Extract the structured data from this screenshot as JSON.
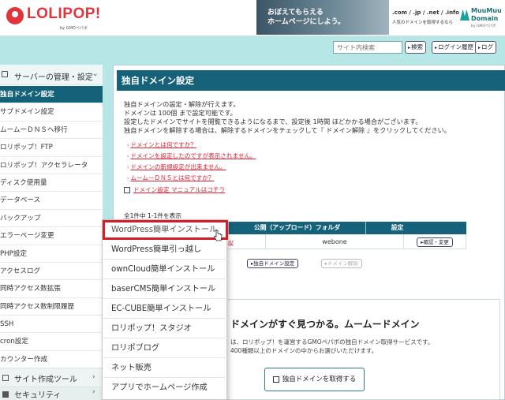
{
  "header": {
    "logo_text": "LOLIPOP!",
    "logo_sub": "by GMOペパボ",
    "banner": {
      "line1": "おぼえてもらえる",
      "line2": "ホームページにしよう。",
      "domains": ".com / .jp / .net / .info",
      "domains_sub": "人気のドメインを取得するなら",
      "brand1": "MuuMuu",
      "brand2": "Domain",
      "brand_sub": "by GMOペパボ"
    }
  },
  "toolbar": {
    "search_placeholder": "サイト内検索",
    "search_button": "検索",
    "login_history_button": "ログイン履歴",
    "logout_button": "ログ"
  },
  "sidebar": {
    "section_label": "サーバーの管理・設定",
    "items": [
      "独自ドメイン設定",
      "サブドメイン設定",
      "ムームーＤＮＳへ移行",
      "ロリポップ！FTP",
      "ロリポップ！アクセラレータ",
      "ディスク使用量",
      "データベース",
      "バックアップ",
      "エラーページ変更",
      "PHP設定",
      "アクセスログ",
      "同時アクセス数拡張",
      "同時アクセス数制限履歴",
      "SSH",
      "cron設定",
      "カウンター作成"
    ],
    "active_index": 0,
    "foot1": "サイト作成ツール",
    "foot2": "セキュリティ"
  },
  "main": {
    "title": "独自ドメイン設定",
    "desc_lines": [
      "独自ドメインの設定・解除が行えます。",
      "ドメインは 100個 まで設定可能です。",
      "設定したドメインでサイトを閲覧できるようになるまで、設定後 1時間 ほどかかる場合がございます。",
      "独自ドメインを解除する場合は、解除するドメインをチェックして『 ドメイン解除 』をクリックしてください。"
    ],
    "links": [
      "ドメインとは何ですか？",
      "ドメインを設定したのですが表示されません。",
      "ドメインの新規設定が出来ません。",
      "ムームーＤＮＳとは何ですか？"
    ],
    "manual": "ドメイン設定 マニュアルはコチラ",
    "count": "全1件中 1-1件を表示",
    "table": {
      "headers": [
        "",
        "公開（アップロード）フォルダ",
        "設定"
      ],
      "row": {
        "domain": "a/",
        "folder": "webone",
        "action": "確認・変更"
      }
    },
    "add_button": "独自ドメイン設定",
    "remove_button": "ドメイン解除"
  },
  "promo": {
    "title": "ドメインがすぐ見つかる。ムームードメイン",
    "text1": "は、ロリポップ！を運営するGMOペパボの独自ドメイン取得サービスです。",
    "text2": "400種類以上のドメインの中からお選びいただけます。",
    "button": "独自ドメインを取得する"
  },
  "menu": {
    "items": [
      "WordPress簡単インストール",
      "WordPress簡単引っ越し",
      "ownCloud簡単インストール",
      "baserCMS簡単インストール",
      "EC-CUBE簡単インストール",
      "ロリポップ！スタジオ",
      "ロリポブログ",
      "ネット販売",
      "アプリでホームページ作成"
    ],
    "highlighted_index": 0
  },
  "colors": {
    "accent": "#15627a",
    "brand": "#e3343c",
    "link": "#d22233",
    "highlight_border": "#d11e2a",
    "background": "#b7e6e6"
  }
}
